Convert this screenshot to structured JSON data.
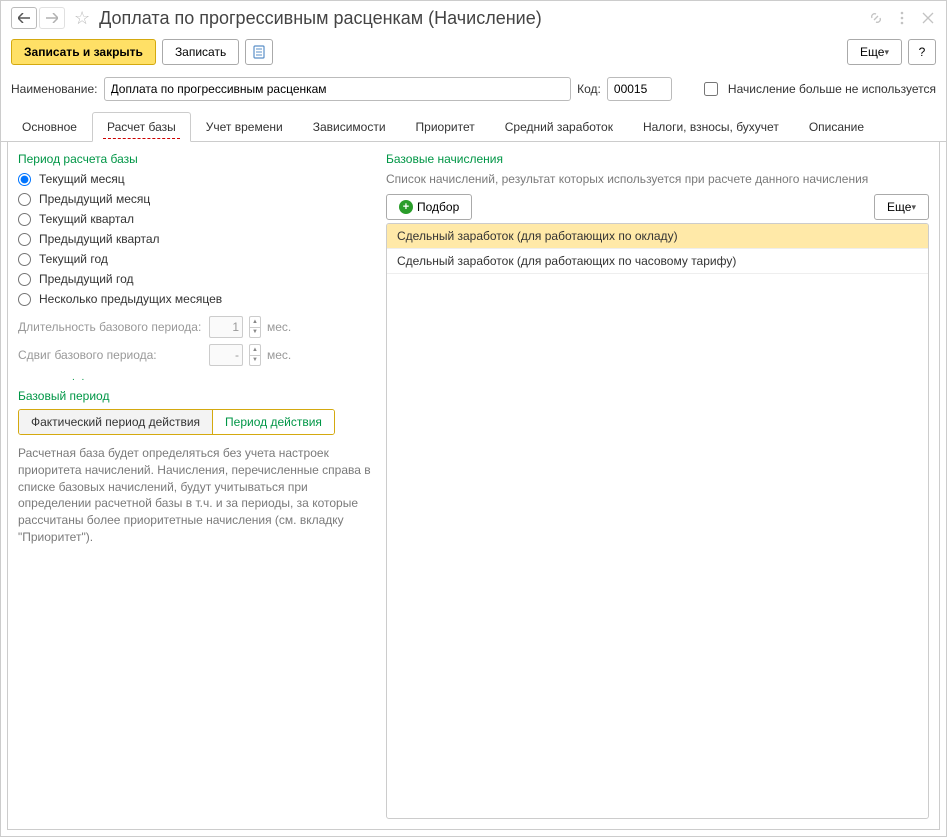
{
  "window": {
    "title": "Доплата по прогрессивным расценкам (Начисление)"
  },
  "toolbar": {
    "save_close": "Записать и закрыть",
    "save": "Записать",
    "more": "Еще",
    "help": "?"
  },
  "form": {
    "name_label": "Наименование:",
    "name_value": "Доплата по прогрессивным расценкам",
    "code_label": "Код:",
    "code_value": "00015",
    "unused_label": "Начисление больше не используется"
  },
  "tabs": [
    {
      "id": "main",
      "label": "Основное"
    },
    {
      "id": "base",
      "label": "Расчет базы"
    },
    {
      "id": "time",
      "label": "Учет времени"
    },
    {
      "id": "deps",
      "label": "Зависимости"
    },
    {
      "id": "prio",
      "label": "Приоритет"
    },
    {
      "id": "avg",
      "label": "Средний заработок"
    },
    {
      "id": "tax",
      "label": "Налоги, взносы, бухучет"
    },
    {
      "id": "desc",
      "label": "Описание"
    }
  ],
  "left": {
    "period_header": "Период расчета базы",
    "radios": [
      "Текущий месяц",
      "Предыдущий месяц",
      "Текущий квартал",
      "Предыдущий квартал",
      "Текущий год",
      "Предыдущий год",
      "Несколько предыдущих месяцев"
    ],
    "selected_radio": 0,
    "len_label": "Длительность базового периода:",
    "len_value": "1",
    "len_unit": "мес.",
    "shift_label": "Сдвиг базового периода:",
    "shift_value": "-",
    "shift_unit": "мес.",
    "base_period_header": "Базовый период",
    "toggle": {
      "actual": "Фактический период действия",
      "validity": "Период действия"
    },
    "help": "Расчетная база будет определяться без учета настроек приоритета начислений. Начисления, перечисленные справа в списке базовых начислений, будут учитываться при определении расчетной базы в т.ч. и за периоды, за которые рассчитаны более приоритетные начисления (см. вкладку \"Приоритет\")."
  },
  "right": {
    "header": "Базовые начисления",
    "desc": "Список начислений, результат которых используется при расчете данного начисления",
    "add_btn": "Подбор",
    "more": "Еще",
    "rows": [
      "Сдельный заработок (для работающих по окладу)",
      "Сдельный заработок (для работающих по часовому тарифу)"
    ],
    "selected_row": 0
  }
}
